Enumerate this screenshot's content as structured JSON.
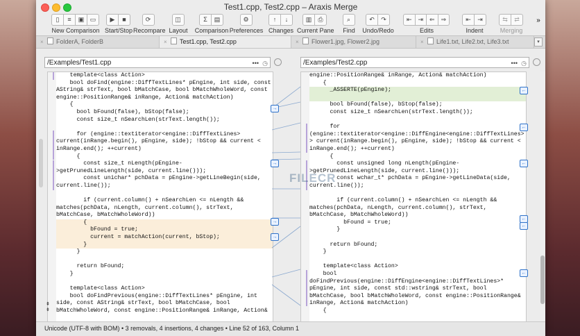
{
  "window": {
    "title": "Test1.cpp, Test2.cpp – Araxis Merge"
  },
  "toolbar": [
    {
      "label": "New Comparison",
      "icons": [
        "doc-new-icon",
        "doc-text-icon",
        "doc-image-icon",
        "folder-icon"
      ]
    },
    {
      "label": "Start/Stop",
      "icons": [
        "play-icon",
        "stop-icon"
      ]
    },
    {
      "label": "Recompare",
      "icons": [
        "recompare-icon"
      ]
    },
    {
      "label": "Layout",
      "icons": [
        "layout-icon"
      ]
    },
    {
      "label": "Comparison",
      "icons": [
        "sigma-icon",
        "document-icon"
      ]
    },
    {
      "label": "Preferences",
      "icons": [
        "gear-icon"
      ]
    },
    {
      "label": "Changes",
      "icons": [
        "arrow-up-icon",
        "arrow-down-icon"
      ]
    },
    {
      "label": "Current Pane",
      "icons": [
        "save-icon",
        "print-icon"
      ]
    },
    {
      "label": "Find",
      "icons": [
        "search-icon"
      ]
    },
    {
      "label": "Undo/Redo",
      "icons": [
        "undo-icon",
        "redo-icon"
      ]
    },
    {
      "label": "Edits",
      "icons": [
        "edit-a-icon",
        "edit-b-icon",
        "edit-c-icon",
        "edit-d-icon"
      ]
    },
    {
      "label": "Indent",
      "icons": [
        "indent-left-icon",
        "indent-right-icon"
      ]
    },
    {
      "label": "Merging",
      "icons": [
        "merge-a-icon",
        "merge-b-icon"
      ],
      "disabled": true
    }
  ],
  "tabs": [
    {
      "label": "FolderA, FolderB",
      "active": false
    },
    {
      "label": "Test1.cpp, Test2.cpp",
      "active": true
    },
    {
      "label": "Flower1.jpg, Flower2.jpg",
      "active": false
    },
    {
      "label": "Life1.txt, Life2.txt, Life3.txt",
      "active": false
    }
  ],
  "left": {
    "path": "/Examples/Test1.cpp",
    "lines": [
      {
        "t": "    template<class Action>"
      },
      {
        "t": "    bool doFind(engine::DiffTextLines* pEngine, int side, const"
      },
      {
        "t": "AString& strText, bool bMatchCase, bool bMatchWholeWord, const"
      },
      {
        "t": "engine::PositionRange& inRange, Action& matchAction)"
      },
      {
        "t": "    {"
      },
      {
        "t": "      bool bFound(false), bStop(false);"
      },
      {
        "t": "      const size_t nSearchLen(strText.length());"
      },
      {
        "t": ""
      },
      {
        "t": "      for (engine::textiterator<engine::DiffTextLines>"
      },
      {
        "t": "current(inRange.begin(), pEngine, side); !bStop && current <"
      },
      {
        "t": "inRange.end(); ++current)"
      },
      {
        "t": "      {"
      },
      {
        "t": "        const size_t nLength(pEngine-"
      },
      {
        "t": ">getPrunedLineLength(side, current.line()));"
      },
      {
        "t": "        const unichar* pchData = pEngine->getLineBegin(side,"
      },
      {
        "t": "current.line());"
      },
      {
        "t": ""
      },
      {
        "t": "        if (current.column() + nSearchLen <= nLength &&"
      },
      {
        "t": "matches(pchData, nLength, current.column(), strText,"
      },
      {
        "t": "bMatchCase, bMatchWholeWord))"
      },
      {
        "t": "        {",
        "hl": "changed"
      },
      {
        "t": "          bFound = true;",
        "hl": "changed"
      },
      {
        "t": "          current = matchAction(current, bStop);",
        "hl": "changed"
      },
      {
        "t": "        }",
        "hl": "changed"
      },
      {
        "t": "      }"
      },
      {
        "t": ""
      },
      {
        "t": "      return bFound;"
      },
      {
        "t": "    }"
      },
      {
        "t": ""
      },
      {
        "t": "    template<class Action>"
      },
      {
        "t": "    bool doFindPrevious(engine::DiffTextLines* pEngine, int"
      },
      {
        "t": "side, const AString& strText, bool bMatchCase, bool"
      },
      {
        "t": "bMatchWholeWord, const engine::PositionRange& inRange, Action&"
      }
    ]
  },
  "right": {
    "path": "/Examples/Test2.cpp",
    "lines": [
      {
        "t": "engine::PositionRange& inRange, Action& matchAction)"
      },
      {
        "t": "    {"
      },
      {
        "t": "      _ASSERTE(pEngine);",
        "hl": "added"
      },
      {
        "t": "",
        "hl": "added"
      },
      {
        "t": "      bool bFound(false), bStop(false);"
      },
      {
        "t": "      const size_t nSearchLen(strText.length());"
      },
      {
        "t": ""
      },
      {
        "t": "      for"
      },
      {
        "t": "(engine::textiterator<engine::DiffEngine<engine::DiffTextLines>"
      },
      {
        "t": "> current(inRange.begin(), pEngine, side); !bStop && current <"
      },
      {
        "t": "inRange.end(); ++current)"
      },
      {
        "t": "      {"
      },
      {
        "t": "        const unsigned long nLength(pEngine-"
      },
      {
        "t": ">getPrunedLineLength(side, current.line()));"
      },
      {
        "t": "        const wchar_t* pchData = pEngine->getLineData(side,"
      },
      {
        "t": "current.line());"
      },
      {
        "t": ""
      },
      {
        "t": "        if (current.column() + nSearchLen <= nLength &&"
      },
      {
        "t": "matches(pchData, nLength, current.column(), strText,"
      },
      {
        "t": "bMatchCase, bMatchWholeWord))"
      },
      {
        "t": "          bFound = true;"
      },
      {
        "t": "        }"
      },
      {
        "t": ""
      },
      {
        "t": "      return bFound;"
      },
      {
        "t": "    }"
      },
      {
        "t": ""
      },
      {
        "t": "    template<class Action>"
      },
      {
        "t": "    bool"
      },
      {
        "t": "doFindPrevious(engine::DiffEngine<engine::DiffTextLines>*"
      },
      {
        "t": "pEngine, int side, const std::wstring& strText, bool"
      },
      {
        "t": "bMatchCase, bool bMatchWholeWord, const engine::PositionRange&"
      },
      {
        "t": "inRange, Action& matchAction)"
      },
      {
        "t": "    {"
      }
    ]
  },
  "status": "Unicode (UTF-8 with BOM) • 3 removals, 4 insertions, 4 changes • Line 52 of 163, Column 1",
  "watermark": "FILECR"
}
